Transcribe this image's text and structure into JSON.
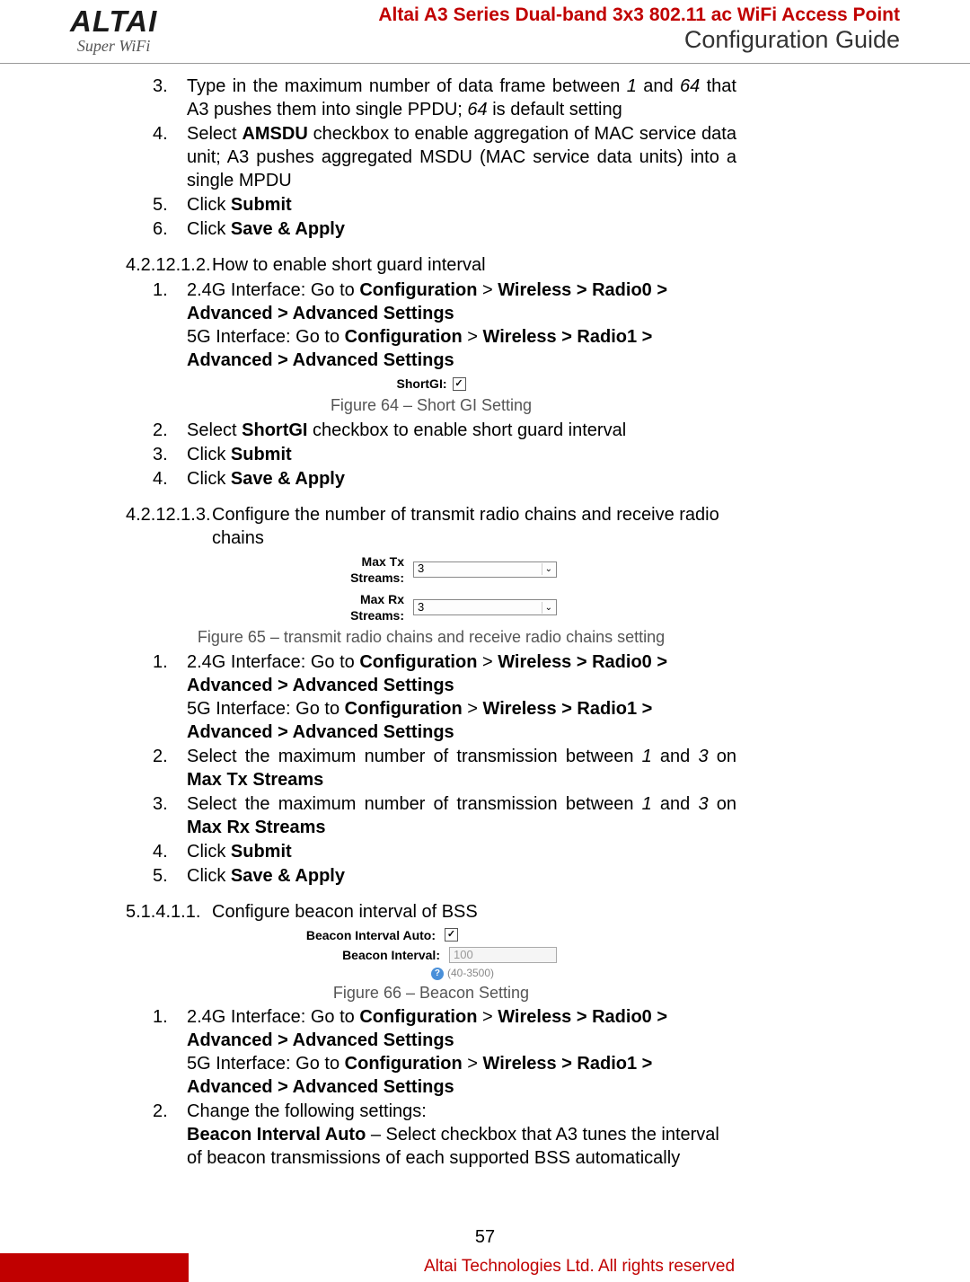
{
  "header": {
    "logo": "ALTAI",
    "logo_sub": "Super WiFi",
    "title": "Altai A3 Series Dual-band 3x3 802.11 ac WiFi Access Point",
    "subtitle": "Configuration Guide"
  },
  "secA": {
    "i3n": "3.",
    "i3a": "Type in the maximum number of data frame between ",
    "i3b": "1",
    "i3c": " and ",
    "i3d": "64",
    "i3e": " that A3 pushes them into single PPDU; ",
    "i3f": "64",
    "i3g": " is default setting",
    "i4n": "4.",
    "i4a": "Select ",
    "i4b": "AMSDU",
    "i4c": " checkbox to enable aggregation of MAC service data unit; A3 pushes aggregated MSDU (MAC service data units) into a single MPDU",
    "i5n": "5.",
    "i5a": "Click ",
    "i5b": "Submit",
    "i6n": "6.",
    "i6a": "Click ",
    "i6b": "Save & Apply"
  },
  "secB": {
    "num": "4.2.12.1.2.",
    "title": "How to enable short guard interval",
    "i1n": "1.",
    "i1a": "2.4G Interface: Go to ",
    "i1b": "Configuration",
    "i1c": " > ",
    "i1d": "Wireless > Radio0 > Advanced > Advanced Settings",
    "i1e": "5G Interface: Go to ",
    "i1f": "Configuration",
    "i1g": " > ",
    "i1h": "Wireless > Radio1 > Advanced > Advanced Settings",
    "fig_label": "ShortGI:",
    "fig_check": "✓",
    "fig_cap": "Figure 64 – Short GI Setting",
    "i2n": "2.",
    "i2a": "Select ",
    "i2b": "ShortGI",
    "i2c": " checkbox to enable short guard interval",
    "i3n": "3.",
    "i3a": "Click ",
    "i3b": "Submit",
    "i4n": "4.",
    "i4a": "Click ",
    "i4b": "Save & Apply"
  },
  "secC": {
    "num": "4.2.12.1.3.",
    "title": "Configure the number of transmit radio chains and receive radio chains",
    "fig_tx_label": "Max Tx Streams:",
    "fig_tx_val": "3",
    "fig_rx_label": "Max Rx Streams:",
    "fig_rx_val": "3",
    "fig_cap": "Figure 65 – transmit radio chains and receive radio chains setting",
    "i1n": "1.",
    "i1a": "2.4G Interface: Go to ",
    "i1b": "Configuration",
    "i1c": " > ",
    "i1d": "Wireless > Radio0 > Advanced > Advanced Settings",
    "i1e": "5G Interface: Go to ",
    "i1f": "Configuration",
    "i1g": " > ",
    "i1h": "Wireless > Radio1 > Advanced > Advanced Settings",
    "i2n": "2.",
    "i2a": "Select the maximum number of transmission between ",
    "i2b": "1",
    "i2c": " and ",
    "i2d": "3",
    "i2e": " on ",
    "i2f": "Max Tx Streams",
    "i3n": "3.",
    "i3a": "Select the maximum number of transmission between ",
    "i3b": "1",
    "i3c": " and ",
    "i3d": "3",
    "i3e": " on ",
    "i3f": "Max Rx Streams",
    "i4n": "4.",
    "i4a": "Click ",
    "i4b": "Submit",
    "i5n": "5.",
    "i5a": "Click ",
    "i5b": "Save & Apply"
  },
  "secD": {
    "num": "5.1.4.1.1.",
    "title": "Configure beacon interval of BSS",
    "fig_auto_label": "Beacon Interval Auto:",
    "fig_auto_check": "✓",
    "fig_int_label": "Beacon Interval:",
    "fig_int_val": "100",
    "fig_hint": "(40-3500)",
    "fig_cap": "Figure 66 – Beacon Setting",
    "i1n": "1.",
    "i1a": "2.4G Interface: Go to ",
    "i1b": "Configuration",
    "i1c": " > ",
    "i1d": "Wireless > Radio0 > Advanced > Advanced Settings",
    "i1e": "5G Interface: Go to ",
    "i1f": "Configuration",
    "i1g": " > ",
    "i1h": "Wireless > Radio1 > Advanced > Advanced Settings",
    "i2n": "2.",
    "i2a": "Change the following settings:",
    "i2b": "Beacon Interval Auto",
    "i2c": " – Select checkbox that A3 tunes the interval of beacon transmissions of each supported BSS automatically"
  },
  "footer": {
    "page": "57",
    "text": "Altai Technologies Ltd. All rights reserved"
  }
}
